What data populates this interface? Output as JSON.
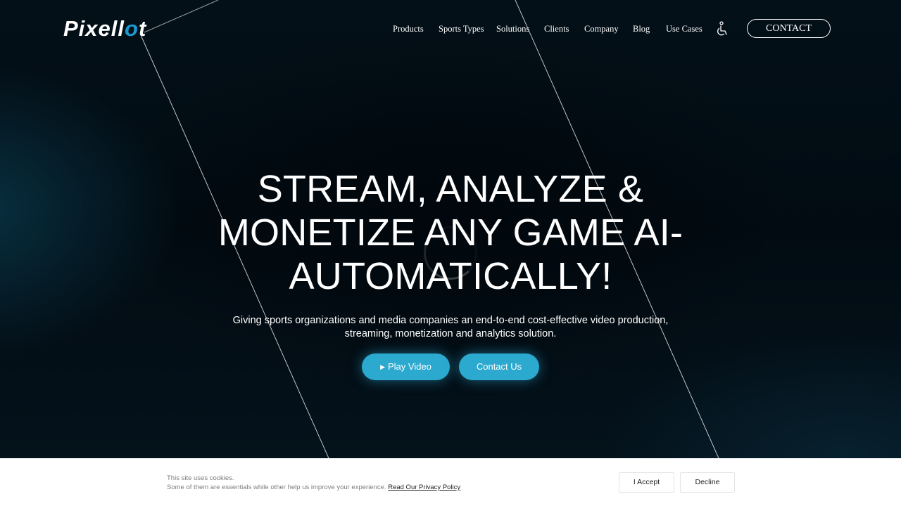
{
  "brand": {
    "logo_text": "Pixellot",
    "accent_color": "#1a9ad0"
  },
  "nav": {
    "items": [
      "Products",
      "Sports Types",
      "Solutions",
      "Clients",
      "Company",
      "Blog",
      "Use Cases"
    ],
    "accessibility_icon": "accessibility-icon",
    "contact_label": "CONTACT"
  },
  "hero": {
    "headline": "STREAM, ANALYZE & MONETIZE ANY GAME AI-AUTOMATICALLY!",
    "subtitle": "Giving sports organizations and media companies an end-to-end cost-effective video production, streaming, monetization and analytics solution.",
    "play_video_label": "Play Video",
    "play_icon": "play-icon",
    "contact_us_label": "Contact Us",
    "button_color": "#2ba9cf"
  },
  "cookie_bar": {
    "line1": "This site uses cookies.",
    "line2": "Some of them are essentials while other help us improve your experience.",
    "privacy_link": "Read Our Privacy Policy",
    "accept_label": "I Accept",
    "decline_label": "Decline"
  }
}
